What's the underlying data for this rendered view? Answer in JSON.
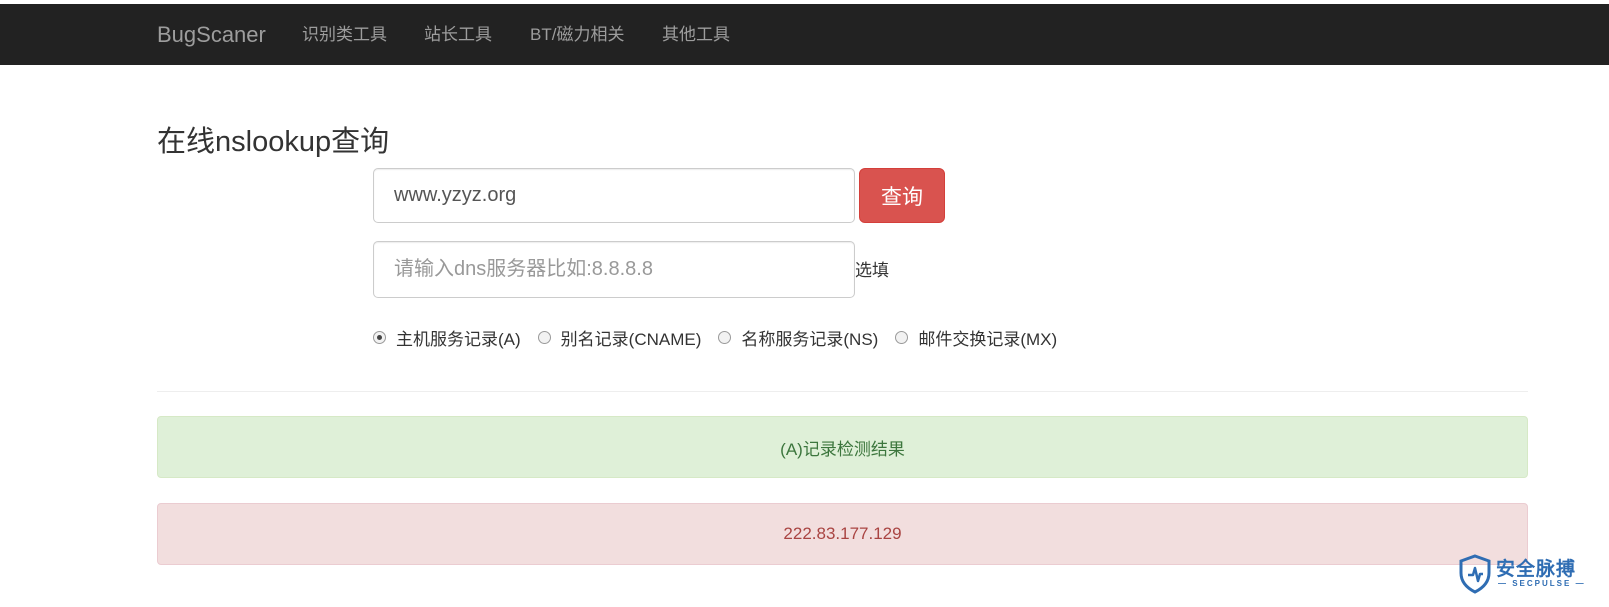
{
  "navbar": {
    "brand": "BugScaner",
    "links": [
      "识别类工具",
      "站长工具",
      "BT/磁力相关",
      "其他工具"
    ]
  },
  "main": {
    "title": "在线nslookup查询",
    "domain_input": {
      "value": "www.yzyz.org"
    },
    "query_button": "查询",
    "dns_input": {
      "placeholder": "请输入dns服务器比如:8.8.8.8",
      "value": ""
    },
    "dns_optional_label": "选填",
    "record_types": [
      {
        "label": "主机服务记录(A)",
        "checked": true
      },
      {
        "label": "别名记录(CNAME)",
        "checked": false
      },
      {
        "label": "名称服务记录(NS)",
        "checked": false
      },
      {
        "label": "邮件交换记录(MX)",
        "checked": false
      }
    ]
  },
  "results": {
    "header": "(A)记录检测结果",
    "value": "222.83.177.129"
  },
  "watermark": {
    "text": "安全脉搏",
    "subtext": "— SECPULSE —"
  },
  "colors": {
    "navbar_bg": "#222222",
    "button_danger": "#d9534f",
    "success_bg": "#dff0d8",
    "danger_bg": "#f2dede",
    "watermark": "#2f6db3"
  }
}
